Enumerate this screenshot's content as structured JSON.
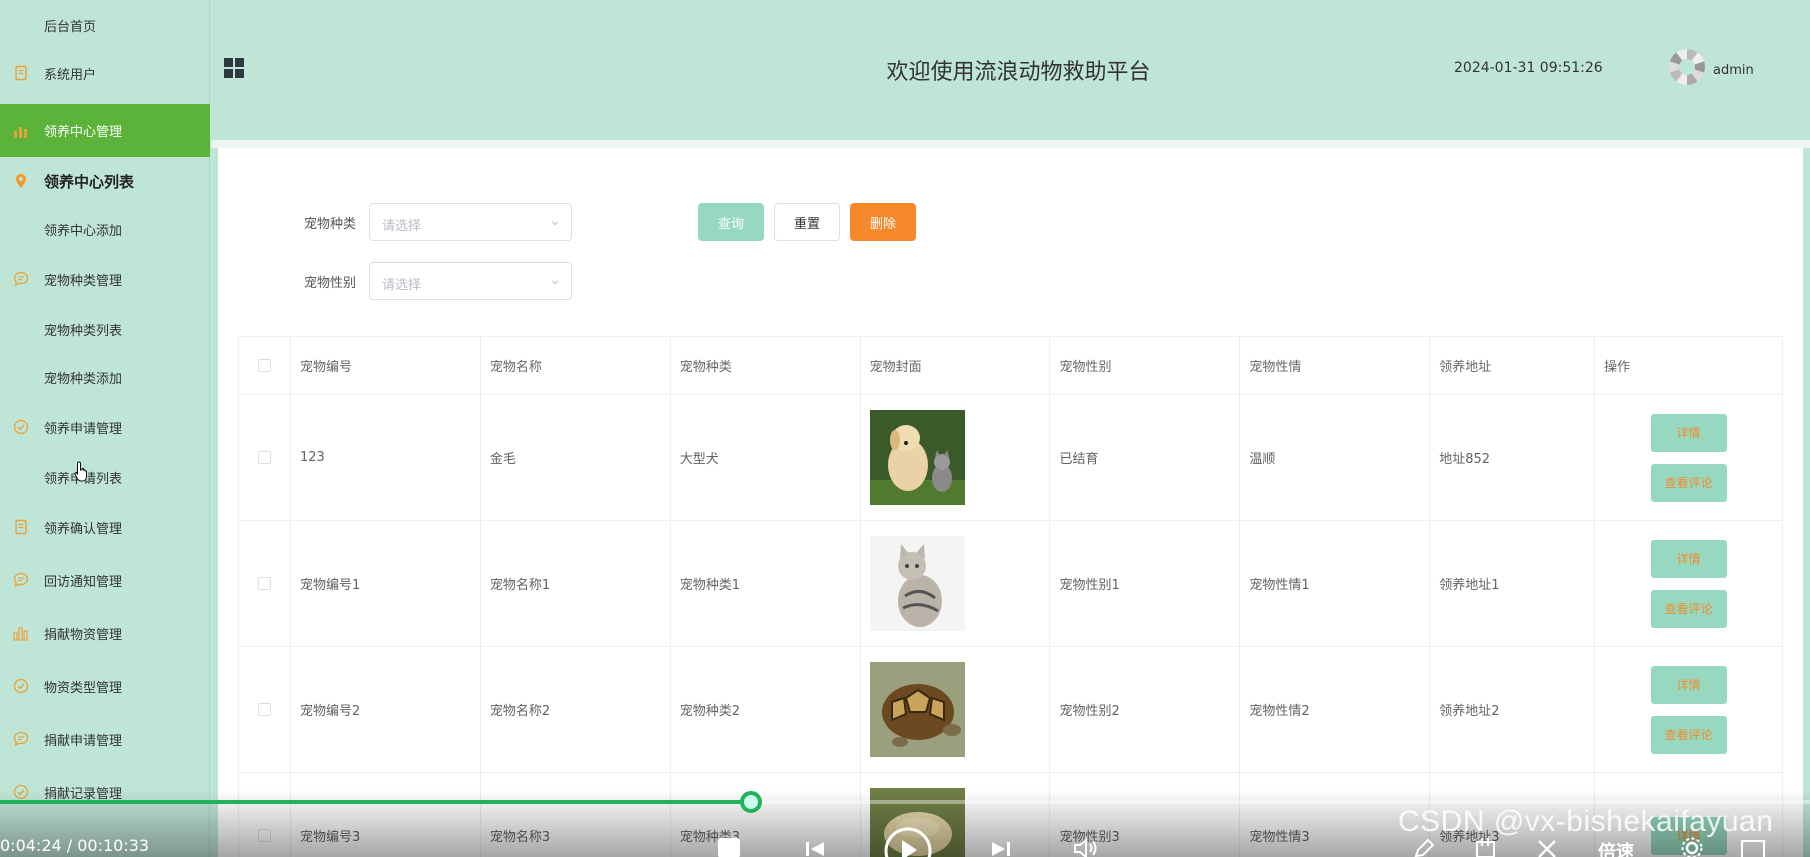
{
  "sidebar": {
    "items": [
      {
        "label": "后台首页",
        "icon": "none",
        "type": "sub"
      },
      {
        "label": "系统用户",
        "icon": "document-icon",
        "type": "item"
      },
      {
        "label": "领养中心管理",
        "icon": "bar-chart-icon",
        "type": "active"
      },
      {
        "label": "领养中心列表",
        "icon": "location-pin-icon",
        "type": "bold"
      },
      {
        "label": "领养中心添加",
        "icon": "none",
        "type": "sub"
      },
      {
        "label": "宠物种类管理",
        "icon": "chat-icon",
        "type": "item"
      },
      {
        "label": "宠物种类列表",
        "icon": "none",
        "type": "sub"
      },
      {
        "label": "宠物种类添加",
        "icon": "none",
        "type": "sub"
      },
      {
        "label": "领养申请管理",
        "icon": "check-circle-icon",
        "type": "item"
      },
      {
        "label": "领养申请列表",
        "icon": "none",
        "type": "sub"
      },
      {
        "label": "领养确认管理",
        "icon": "document-icon",
        "type": "item"
      },
      {
        "label": "回访通知管理",
        "icon": "chat-icon",
        "type": "item"
      },
      {
        "label": "捐献物资管理",
        "icon": "bar-chart-icon",
        "type": "item"
      },
      {
        "label": "物资类型管理",
        "icon": "check-circle-icon",
        "type": "item"
      },
      {
        "label": "捐献申请管理",
        "icon": "chat-icon",
        "type": "item"
      },
      {
        "label": "捐献记录管理",
        "icon": "check-circle-icon",
        "type": "item"
      }
    ]
  },
  "header": {
    "title": "欢迎使用流浪动物救助平台",
    "datetime": "2024-01-31 09:51:26",
    "username": "admin"
  },
  "filters": {
    "species_label": "宠物种类",
    "species_placeholder": "请选择",
    "gender_label": "宠物性别",
    "gender_placeholder": "请选择",
    "query_label": "查询",
    "reset_label": "重置",
    "delete_label": "删除"
  },
  "table": {
    "columns": [
      "宠物编号",
      "宠物名称",
      "宠物种类",
      "宠物封面",
      "宠物性别",
      "宠物性情",
      "领养地址",
      "操作"
    ],
    "rows": [
      {
        "id": "123",
        "name": "金毛",
        "species": "大型犬",
        "cover": "dog-and-kitten-photo",
        "gender": "已结育",
        "temper": "温顺",
        "address": "地址852"
      },
      {
        "id": "宠物编号1",
        "name": "宠物名称1",
        "species": "宠物种类1",
        "cover": "cat-photo",
        "gender": "宠物性别1",
        "temper": "宠物性情1",
        "address": "领养地址1"
      },
      {
        "id": "宠物编号2",
        "name": "宠物名称2",
        "species": "宠物种类2",
        "cover": "tortoise-photo",
        "gender": "宠物性别2",
        "temper": "宠物性情2",
        "address": "领养地址2"
      },
      {
        "id": "宠物编号3",
        "name": "宠物名称3",
        "species": "宠物种类3",
        "cover": "tortoise-photo",
        "gender": "宠物性别3",
        "temper": "宠物性情3",
        "address": "领养地址3"
      }
    ],
    "detail_label": "详情",
    "comment_label": "查看评论"
  },
  "video": {
    "timecode": "0:04:24 / 00:10:33",
    "progress": 0.415,
    "watermark": "CSDN @vx-bishekaifayuan",
    "speed_label": "倍速"
  },
  "colors": {
    "background": "#bfe5d6",
    "active_menu": "#5bb33a",
    "primary_button": "#97d9c0",
    "delete_button": "#f7892b",
    "progress": "#21b35a"
  }
}
